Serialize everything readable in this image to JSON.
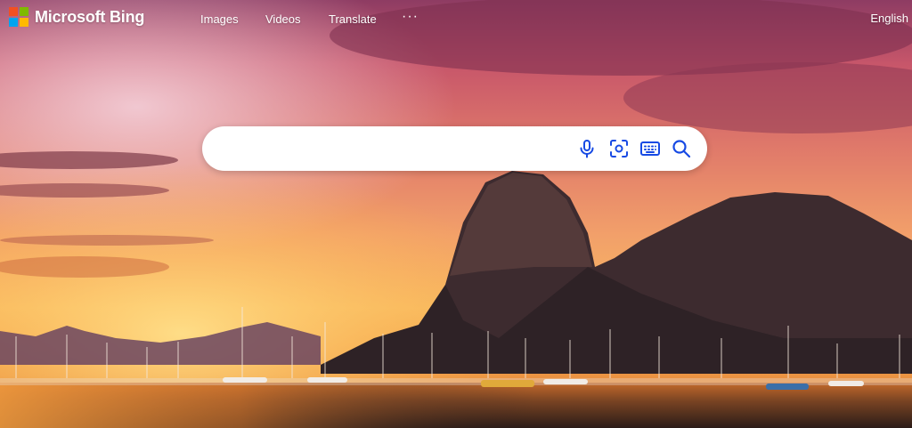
{
  "brand": {
    "name": "Microsoft Bing",
    "logo_colors": [
      "#f25022",
      "#7fba00",
      "#00a4ef",
      "#ffb900"
    ]
  },
  "nav": {
    "images": "Images",
    "videos": "Videos",
    "translate": "Translate",
    "more_icon": "ellipsis-icon"
  },
  "language": "English",
  "search": {
    "value": "",
    "placeholder": "",
    "icons": [
      "microphone-icon",
      "visual-search-icon",
      "keyboard-icon",
      "search-icon"
    ],
    "icon_color": "#174ae4"
  },
  "background": {
    "description_colors": [
      "#b74a5c",
      "#f08a4b",
      "#2b1a24"
    ]
  }
}
